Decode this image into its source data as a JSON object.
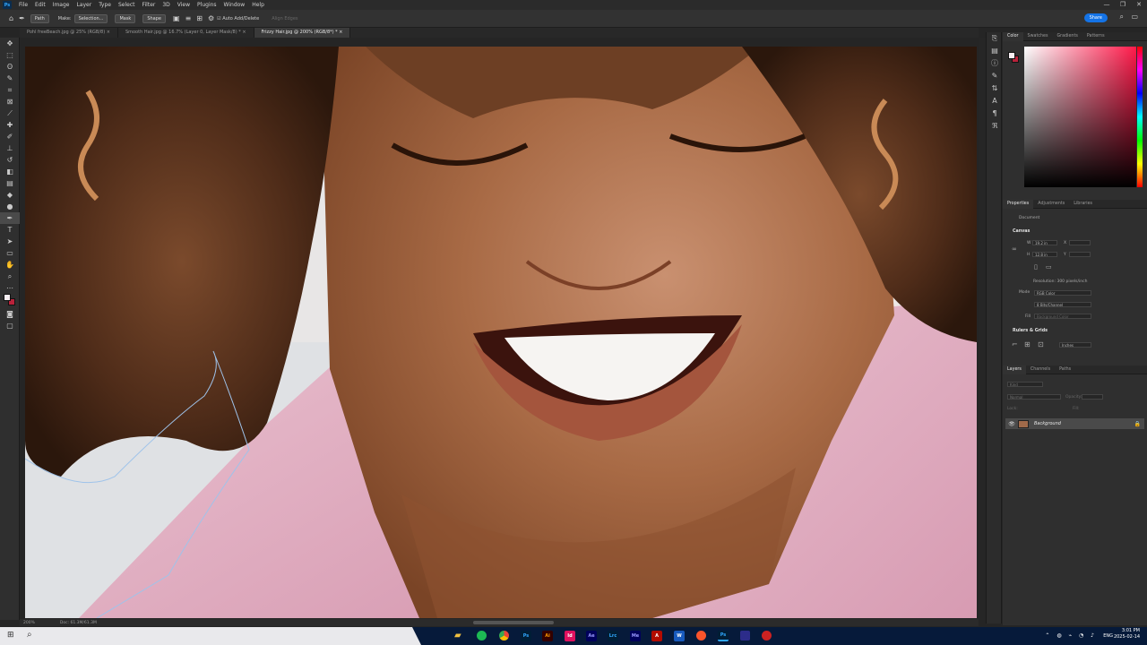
{
  "menu": [
    "File",
    "Edit",
    "Image",
    "Layer",
    "Type",
    "Select",
    "Filter",
    "3D",
    "View",
    "Plugins",
    "Window",
    "Help"
  ],
  "app_logo": "Ps",
  "window_controls": [
    "—",
    "❐",
    "✕"
  ],
  "options": {
    "tool_mode": "Path",
    "make_label": "Make:",
    "selection_btn": "Selection...",
    "mask_btn": "Mask",
    "shape_btn": "Shape",
    "auto_add_delete": "Auto Add/Delete",
    "align_edges": "Align Edges",
    "share": "Share"
  },
  "tabs": [
    {
      "label": "Pohl freeBeach.jpg @ 25% (RGB/8)",
      "active": false
    },
    {
      "label": "Smooth Hair.jpg @ 16.7% (Layer 0, Layer Mask/8) *",
      "active": false
    },
    {
      "label": "Frizzy Hair.jpg @ 200% (RGB/8*) *",
      "active": true
    }
  ],
  "tab_close": "×",
  "status": {
    "zoom": "200%",
    "doc": "Doc: 61.3M/61.3M"
  },
  "color_panel": {
    "tabs": [
      "Color",
      "Swatches",
      "Gradients",
      "Patterns"
    ]
  },
  "properties_panel": {
    "tabs": [
      "Properties",
      "Adjustments",
      "Libraries"
    ],
    "doc_label": "Document",
    "canvas_label": "Canvas",
    "w_label": "W",
    "w_value": "19.2 in",
    "h_label": "H",
    "h_value": "12.8 in",
    "x_label": "X",
    "y_label": "Y",
    "resolution": "Resolution: 300 pixels/inch",
    "mode_label": "Mode",
    "mode_value": "RGB Color",
    "depth_value": "8 Bits/Channel",
    "fill_label": "Fill",
    "fill_value": "Background Color",
    "rulers_label": "Rulers & Grids",
    "units_value": "Inches"
  },
  "layers_panel": {
    "tabs": [
      "Layers",
      "Channels",
      "Paths"
    ],
    "kind_placeholder": "Kind",
    "blend_mode": "Normal",
    "opacity_label": "Opacity:",
    "lock_label": "Lock:",
    "fill_label": "Fill:",
    "layer_name": "Background"
  },
  "taskbar": {
    "apps": [
      {
        "label": "Ps",
        "color": "#31a8ff",
        "bg": "#001e36"
      },
      {
        "label": "Ai",
        "color": "#ff9a00",
        "bg": "#330000"
      },
      {
        "label": "Id",
        "color": "#fff",
        "bg": "#e0115f"
      },
      {
        "label": "Ae",
        "color": "#9999ff",
        "bg": "#00005b"
      },
      {
        "label": "Lrc",
        "color": "#31a8ff",
        "bg": "#001e36"
      },
      {
        "label": "Me",
        "color": "#9999ff",
        "bg": "#00005b"
      },
      {
        "label": "W",
        "color": "#fff",
        "bg": "#185abd"
      },
      {
        "label": "Ps",
        "color": "#31a8ff",
        "bg": "#001e36"
      }
    ],
    "lang": "ENG",
    "time": "3:01 PM",
    "date": "2025-02-14"
  },
  "colors": {
    "accent": "#1473e6",
    "pink": "#ff1a4a"
  }
}
